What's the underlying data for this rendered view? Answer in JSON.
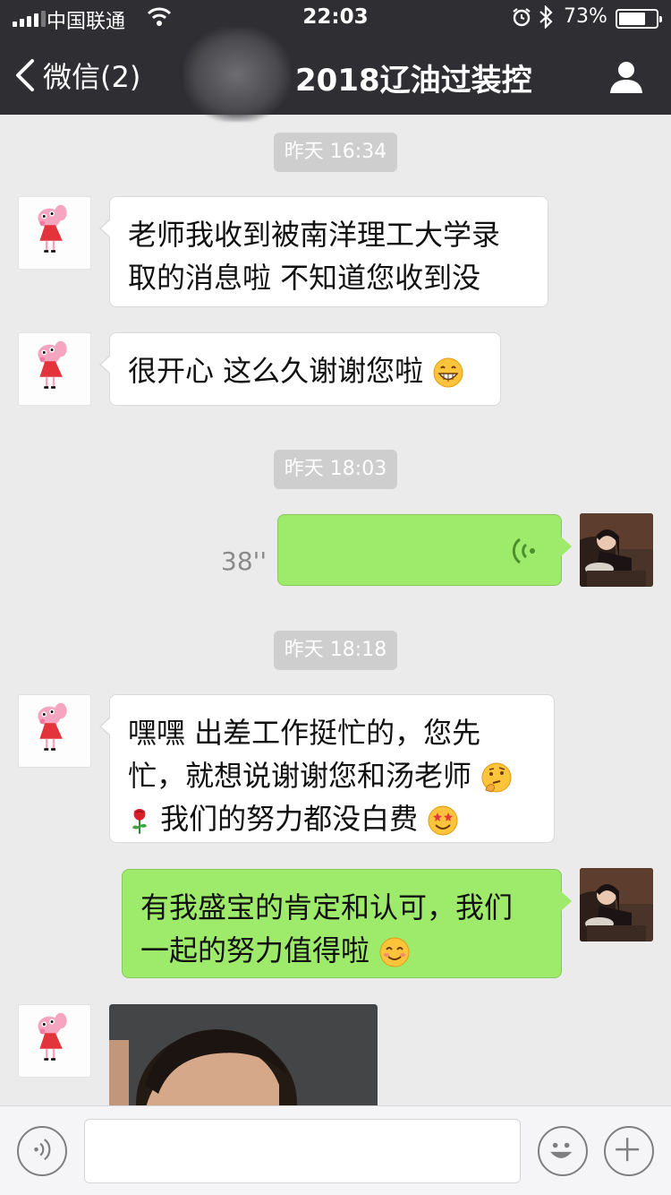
{
  "status_bar": {
    "carrier": "中国联通",
    "time": "22:03",
    "battery_percent": "73%",
    "battery_level": 0.73,
    "icons": [
      "signal-icon",
      "wifi-icon",
      "alarm-icon",
      "bluetooth-icon",
      "battery-icon"
    ]
  },
  "nav": {
    "back_label": "微信(2)",
    "title": "2018辽油过装控",
    "profile_icon": "person-icon"
  },
  "messages": {
    "stamp1": "昨天 16:34",
    "m1": {
      "from": "peppa",
      "lines": [
        "老师我收到被南洋理工大学录",
        "取的消息啦 不知道您收到没"
      ]
    },
    "m2": {
      "from": "peppa",
      "text": "很开心 这么久谢谢您啦",
      "emoji": "grin-emoji"
    },
    "stamp2": "昨天 18:03",
    "m3": {
      "from": "me",
      "type": "voice",
      "duration": "38''"
    },
    "stamp3": "昨天 18:18",
    "m4": {
      "from": "peppa",
      "line1": "嘿嘿 出差工作挺忙的，您先",
      "line2": "忙，就想说谢谢您和汤老师",
      "line2_emoji": "thinking-emoji",
      "line3_emoji_pre": "rose-emoji",
      "line3": "我们的努力都没白费",
      "line3_emoji": "star-eyes-emoji"
    },
    "m5": {
      "from": "me",
      "line1": "有我盛宝的肯定和认可，我们",
      "line2": "一起的努力值得啦",
      "line2_emoji": "smile-emoji"
    },
    "m6": {
      "from": "peppa",
      "type": "image"
    }
  },
  "input_bar": {
    "voice_icon": "voice-mode-icon",
    "emoji_icon": "emoji-face-icon",
    "more_icon": "plus-icon",
    "text_value": ""
  },
  "colors": {
    "nav_bg": "#2e2e33",
    "chat_bg": "#ebebeb",
    "outgoing_bubble": "#9eea6a",
    "incoming_bubble": "#ffffff",
    "timestamp_bg": "#cecece"
  }
}
